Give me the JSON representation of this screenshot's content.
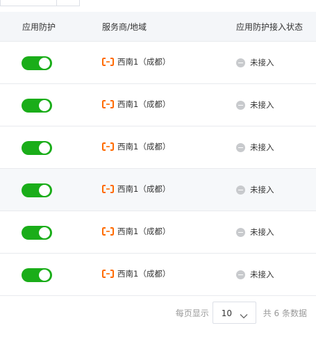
{
  "table": {
    "headers": {
      "protection": "应用防护",
      "provider": "服务商/地域",
      "status": "应用防护接入状态"
    },
    "rows": [
      {
        "protection_on": true,
        "provider": "西南1（成都）",
        "status": "未接入"
      },
      {
        "protection_on": true,
        "provider": "西南1（成都）",
        "status": "未接入"
      },
      {
        "protection_on": true,
        "provider": "西南1（成都）",
        "status": "未接入"
      },
      {
        "protection_on": true,
        "provider": "西南1（成都）",
        "status": "未接入"
      },
      {
        "protection_on": true,
        "provider": "西南1（成都）",
        "status": "未接入"
      },
      {
        "protection_on": true,
        "provider": "西南1（成都）",
        "status": "未接入"
      }
    ]
  },
  "pagination": {
    "per_page_label": "每页显示",
    "per_page_value": "10",
    "total_label": "共 6 条数据"
  },
  "icons": {
    "provider_logo": "aliyun-logo-icon",
    "status": "minus-circle-icon",
    "select_arrow": "chevron-down-icon"
  },
  "colors": {
    "toggle_on": "#1aad19",
    "provider_logo": "#ff6a00",
    "status_dot": "#c8cacd",
    "header_bg": "#f4f6f9"
  }
}
